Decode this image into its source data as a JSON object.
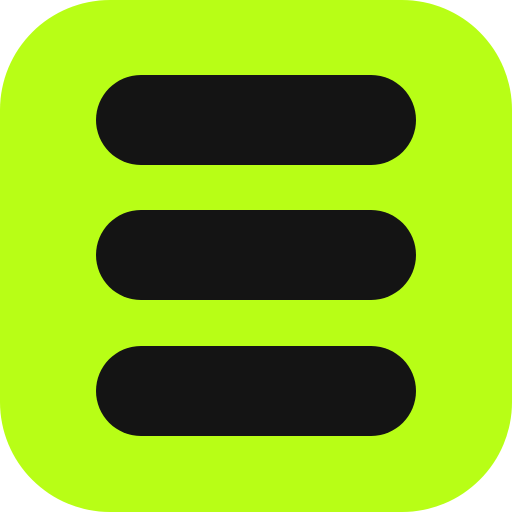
{
  "icon": {
    "name": "hamburger-menu-icon",
    "background_color": "#b8fe16",
    "bar_color": "#141414",
    "bar_count": 3
  }
}
